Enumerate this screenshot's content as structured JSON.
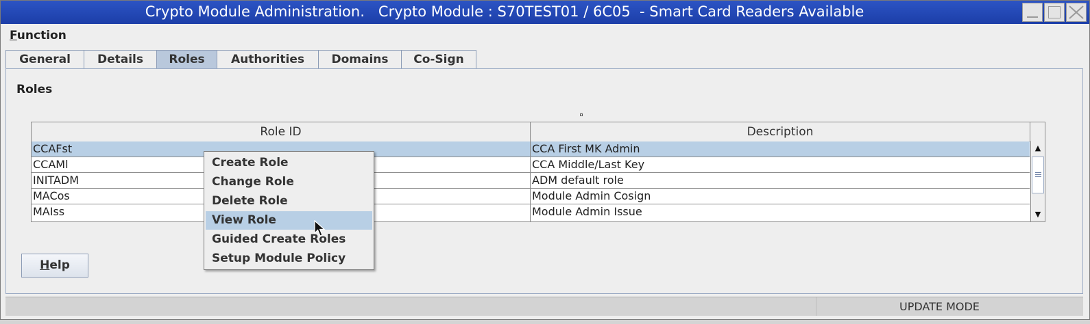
{
  "window": {
    "title": "Crypto Module Administration.   Crypto Module : S70TEST01 / 6C05  - Smart Card Readers Available",
    "buttons": [
      "minimize-icon",
      "maximize-icon",
      "close-icon"
    ]
  },
  "menubar": {
    "function_label_accel": "F",
    "function_label_rest": "unction"
  },
  "tabs": [
    {
      "label": "General",
      "active": false
    },
    {
      "label": "Details",
      "active": false
    },
    {
      "label": "Roles",
      "active": true
    },
    {
      "label": "Authorities",
      "active": false
    },
    {
      "label": "Domains",
      "active": false
    },
    {
      "label": "Co-Sign",
      "active": false
    }
  ],
  "panel": {
    "title": "Roles"
  },
  "table": {
    "columns": [
      "Role ID",
      "Description"
    ],
    "rows": [
      {
        "role_id": "CCAFst",
        "description": "CCA First MK Admin",
        "selected": true
      },
      {
        "role_id": "CCAMl",
        "description": "CCA Middle/Last Key",
        "selected": false
      },
      {
        "role_id": "INITADM",
        "description": "ADM default role",
        "selected": false
      },
      {
        "role_id": "MACos",
        "description": "Module Admin Cosign",
        "selected": false
      },
      {
        "role_id": "MAIss",
        "description": "Module Admin Issue",
        "selected": false
      }
    ]
  },
  "context_menu": {
    "items": [
      "Create Role",
      "Change Role",
      "Delete Role",
      "View Role",
      "Guided Create Roles",
      "Setup Module Policy"
    ],
    "highlighted_index": 3
  },
  "help_button": {
    "accel": "H",
    "rest": "elp"
  },
  "statusbar": {
    "mode": "UPDATE MODE"
  },
  "colors": {
    "titlebar": "#1f44b0",
    "selection": "#b8cfe5",
    "active_tab": "#b9c8dc"
  }
}
